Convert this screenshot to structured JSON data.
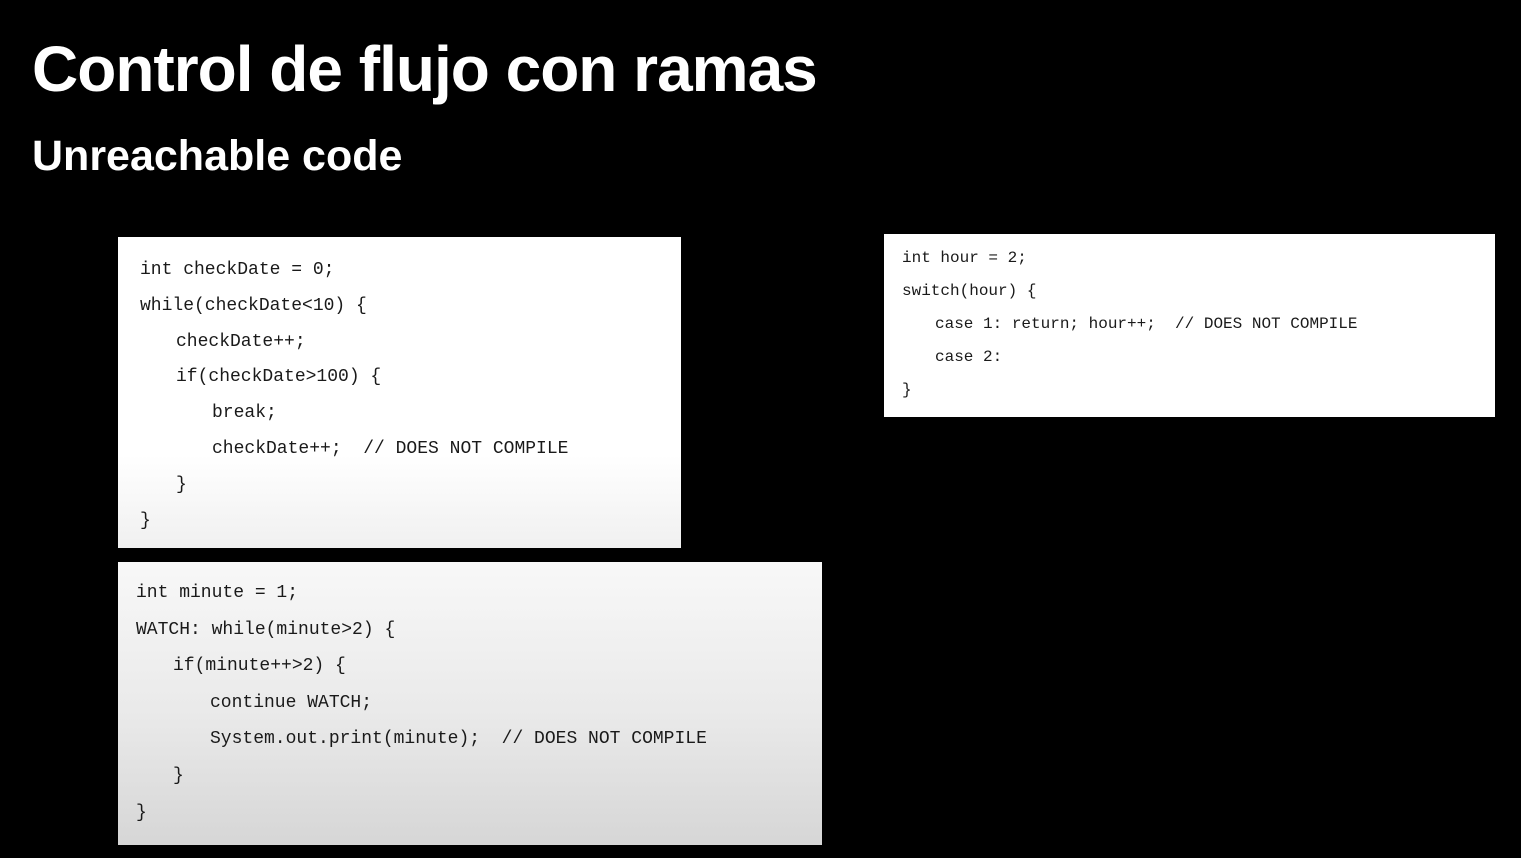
{
  "slide": {
    "title": "Control de flujo con ramas",
    "subtitle": "Unreachable code"
  },
  "code_blocks": {
    "checkdate": {
      "lines": [
        "int checkDate = 0;",
        "while(checkDate<10) {",
        "checkDate++;",
        "if(checkDate>100) {",
        "break;",
        "checkDate++;  // DOES NOT COMPILE",
        "}",
        "}"
      ]
    },
    "minute": {
      "lines": [
        "int minute = 1;",
        "WATCH: while(minute>2) {",
        "if(minute++>2) {",
        "continue WATCH;",
        "System.out.print(minute);  // DOES NOT COMPILE",
        "}",
        "}"
      ]
    },
    "hour": {
      "lines": [
        "int hour = 2;",
        "switch(hour) {",
        "case 1: return; hour++;  // DOES NOT COMPILE",
        "case 2:",
        "}"
      ]
    }
  }
}
